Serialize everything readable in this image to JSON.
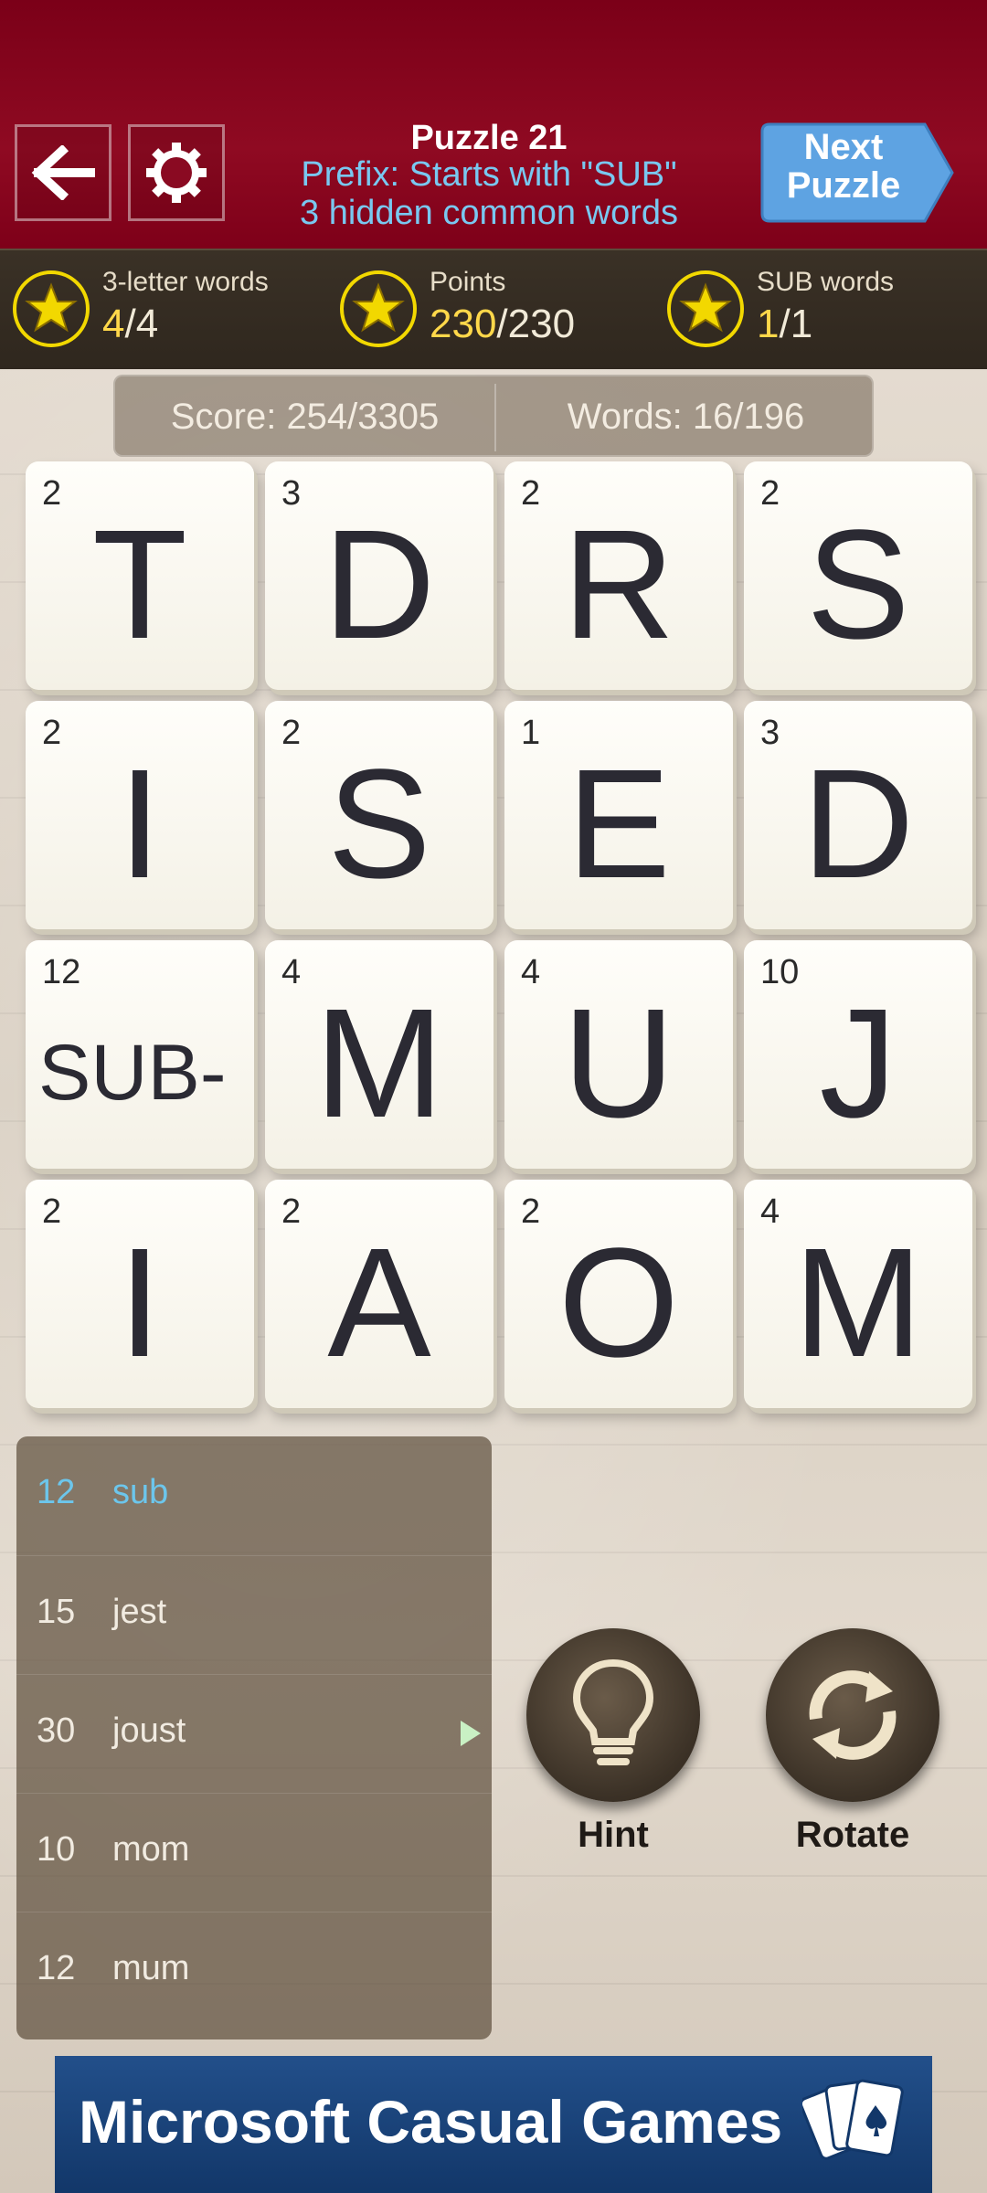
{
  "header": {
    "title": "Puzzle 21",
    "subtitle_1": "Prefix: Starts with \"SUB\"",
    "subtitle_2": "3 hidden common words",
    "next_label_1": "Next",
    "next_label_2": "Puzzle",
    "back_icon": "arrow-left-icon",
    "settings_icon": "gear-icon"
  },
  "stats": [
    {
      "label": "3-letter words",
      "current": "4",
      "total": "/4"
    },
    {
      "label": "Points",
      "current": "230",
      "total": "/230"
    },
    {
      "label": "SUB words",
      "current": "1",
      "total": "/1"
    }
  ],
  "score": {
    "score_text": "Score: 254/3305",
    "words_text": "Words: 16/196"
  },
  "tiles": [
    [
      {
        "pts": "2",
        "letter": "T"
      },
      {
        "pts": "3",
        "letter": "D"
      },
      {
        "pts": "2",
        "letter": "R"
      },
      {
        "pts": "2",
        "letter": "S"
      }
    ],
    [
      {
        "pts": "2",
        "letter": "I"
      },
      {
        "pts": "2",
        "letter": "S"
      },
      {
        "pts": "1",
        "letter": "E"
      },
      {
        "pts": "3",
        "letter": "D"
      }
    ],
    [
      {
        "pts": "12",
        "letter": "SUB-"
      },
      {
        "pts": "4",
        "letter": "M"
      },
      {
        "pts": "4",
        "letter": "U"
      },
      {
        "pts": "10",
        "letter": "J"
      }
    ],
    [
      {
        "pts": "2",
        "letter": "I"
      },
      {
        "pts": "2",
        "letter": "A"
      },
      {
        "pts": "2",
        "letter": "O"
      },
      {
        "pts": "4",
        "letter": "M"
      }
    ]
  ],
  "words": [
    {
      "pts": "12",
      "word": "sub"
    },
    {
      "pts": "15",
      "word": "jest"
    },
    {
      "pts": "30",
      "word": "joust"
    },
    {
      "pts": "10",
      "word": "mom"
    },
    {
      "pts": "12",
      "word": "mum"
    }
  ],
  "buttons": {
    "hint_label": "Hint",
    "rotate_label": "Rotate"
  },
  "footer": {
    "brand": "Microsoft Casual Games"
  },
  "colors": {
    "header_red": "#8f0a22",
    "accent_blue": "#79c8f0",
    "star_yellow": "#f2d800"
  }
}
